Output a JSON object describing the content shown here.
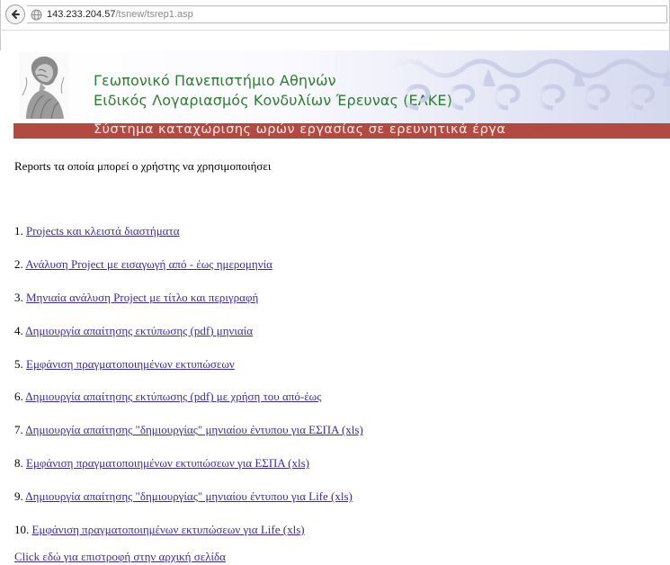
{
  "browser": {
    "url_host": "143.233.204.57",
    "url_path": "/tsnew/tsrep1.asp",
    "icons": {
      "back": "back-arrow-icon",
      "site": "globe-icon"
    }
  },
  "banner": {
    "title": "Γεωπονικό Πανεπιστήμιο Αθηνών",
    "subtitle": "Ειδικός Λογαριασμός Κονδυλίων Έρευνας (ΕΛΚΕ)",
    "system_name": "Σύστημα καταχώρισης ωρών εργασίας σε ερευνητικά έργα",
    "colors": {
      "title": "#2e7d32",
      "bar": "#b24a42",
      "link": "#3a2aa0"
    }
  },
  "page": {
    "intro": "Reports τα οποία μπορεί ο χρήστης να χρησιμοποιήσει",
    "reports": [
      {
        "number": "1.",
        "label": "Projects και κλειστά διαστήματα"
      },
      {
        "number": "2.",
        "label": "Ανάλυση Project με εισαγωγή από - έως ημερομηνία"
      },
      {
        "number": "3.",
        "label": "Μηνιαία ανάλυση Project με τίτλο και περιγραφή"
      },
      {
        "number": "4.",
        "label": "Δημιουργία απαίτησης εκτύπωσης (pdf) μηνιαία"
      },
      {
        "number": "5.",
        "label": "Εμφάνιση πραγματοποιημένων εκτυπώσεων"
      },
      {
        "number": "6.",
        "label": "Δημιουργία απαίτησης εκτύπωσης (pdf) με χρήση του από-έως"
      },
      {
        "number": "7.",
        "label": "Δημιουργία απαίτησης \"δημιουργίας\" μηνιαίου έντυπου για ΕΣΠΑ (xls)"
      },
      {
        "number": "8.",
        "label": "Εμφάνιση πραγματοποιημένων εκτυπώσεων για ΕΣΠΑ (xls)"
      },
      {
        "number": "9.",
        "label": "Δημιουργία απαίτησης \"δημιουργίας\" μηνιαίου έντυπου για Life (xls)"
      },
      {
        "number": "10.",
        "label": "Εμφάνιση πραγματοποιημένων εκτυπώσεων για Life (xls)"
      }
    ],
    "home_link": "Click εδώ για επιστροφή στην αρχική σελίδα"
  }
}
